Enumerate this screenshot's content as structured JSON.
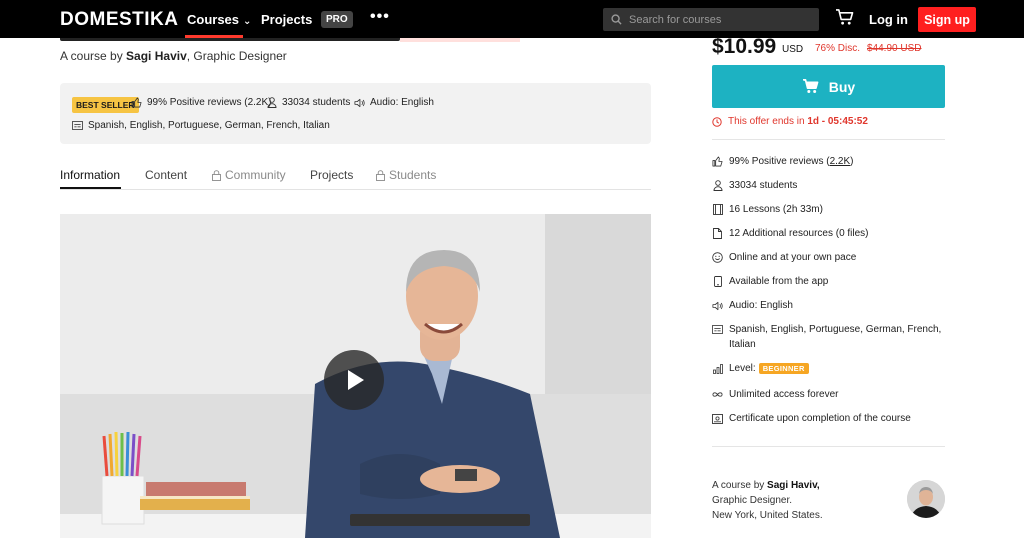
{
  "nav": {
    "logo": "DOMESTIKA",
    "courses_label": "Courses",
    "projects_label": "Projects",
    "pro_label": "PRO",
    "more_label": "•••",
    "search_placeholder": "Search for courses",
    "login_label": "Log in",
    "signup_label": "Sign up"
  },
  "course": {
    "byline_prefix": "A course by",
    "author": "Sagi Haviv",
    "author_role": ", Graphic Designer"
  },
  "info": {
    "badge": "BEST SELLER",
    "reviews": "99% Positive reviews (2.2K)",
    "students": "33034 students",
    "audio": "Audio: English",
    "subtitles": "Spanish, English, Portuguese, German, French, Italian"
  },
  "tabs": [
    {
      "label": "Information",
      "locked": false
    },
    {
      "label": "Content",
      "locked": false
    },
    {
      "label": "Community",
      "locked": true
    },
    {
      "label": "Projects",
      "locked": false
    },
    {
      "label": "Students",
      "locked": true
    }
  ],
  "pricing": {
    "price": "$10.99",
    "currency": "USD",
    "discount": "76% Disc.",
    "old_price": "$44.90 USD",
    "buy_label": "Buy",
    "offer_prefix": "This offer ends in",
    "offer_time": "1d - 05:45:52"
  },
  "features": {
    "reviews_prefix": "99% Positive reviews (",
    "reviews_link": "2.2K",
    "reviews_suffix": ")",
    "students": "33034 students",
    "lessons": "16 Lessons (2h 33m)",
    "resources": "12 Additional resources (0 files)",
    "pace": "Online and at your own pace",
    "app": "Available from the app",
    "audio": "Audio: English",
    "subtitles": "Spanish, English, Portuguese, German, French, Italian",
    "level_prefix": "Level:",
    "level_badge": "BEGINNER",
    "access": "Unlimited access forever",
    "certificate": "Certificate upon completion of the course"
  },
  "author_card": {
    "line1_prefix": "A course by",
    "line1_name": "Sagi Haviv,",
    "line2": "Graphic Designer.",
    "line3": "New York, United States."
  },
  "colors": {
    "accent_red": "#ff1f1f",
    "buy_teal": "#1db2c2",
    "badge_yellow": "#f6c443",
    "level_orange": "#f6a623"
  }
}
